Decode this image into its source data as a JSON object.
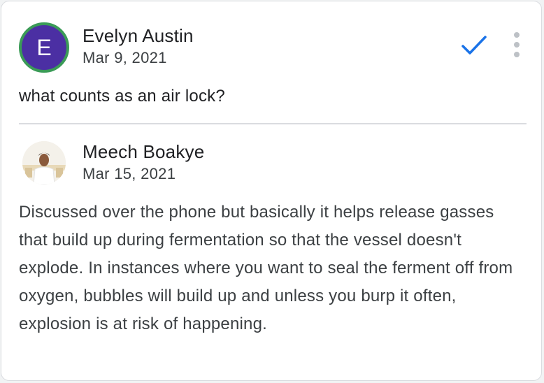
{
  "thread": {
    "original": {
      "avatar_letter": "E",
      "author": "Evelyn Austin",
      "date": "Mar 9, 2021",
      "text": "what counts as an air lock?"
    },
    "reply": {
      "author": "Meech Boakye",
      "date": "Mar 15, 2021",
      "text": "Discussed over the phone but basically it helps release gasses that build up during fermentation so that the vessel doesn't explode. In instances where you want to seal the ferment off from oxygen, bubbles will build up and unless you burp it often, explosion is at risk of happening."
    }
  },
  "icons": {
    "resolve": "check-icon",
    "more": "more-vert-icon"
  },
  "colors": {
    "avatar_bg": "#4b2fa3",
    "avatar_ring": "#3b9b57",
    "check": "#1a73e8"
  }
}
